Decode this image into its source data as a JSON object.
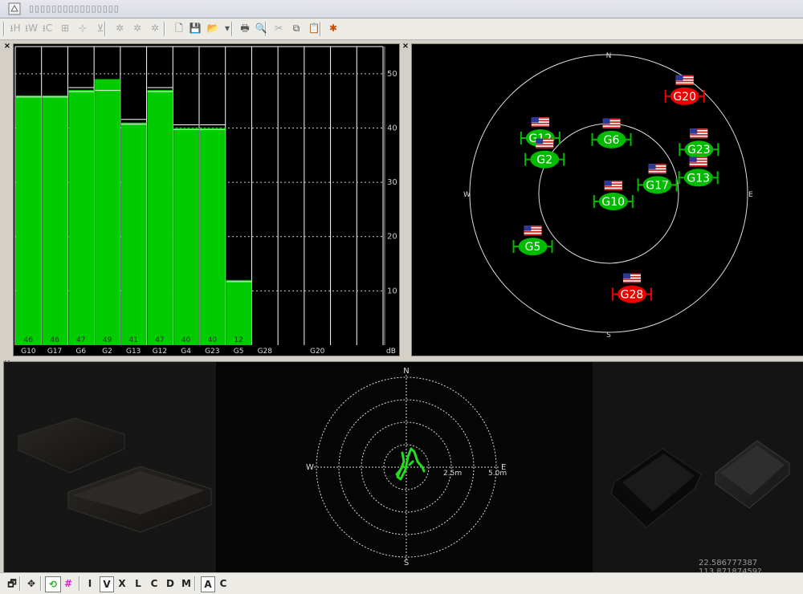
{
  "window": {
    "title": "▯▯▯▯▯▯▯▯▯▯▯▯▯▯▯▯"
  },
  "toolbar": {
    "items": [
      {
        "icon": "hold-h-icon",
        "glyph": "⭳H"
      },
      {
        "icon": "hold-w-icon",
        "glyph": "⭳W"
      },
      {
        "icon": "hold-c-icon",
        "glyph": "⭳C"
      },
      {
        "icon": "grid-add-icon",
        "glyph": "⊞"
      },
      {
        "icon": "grid-move-icon",
        "glyph": "⊹"
      },
      {
        "icon": "grid-split-icon",
        "glyph": "⊻"
      },
      {
        "icon": "settings-gear-1-icon",
        "glyph": "✲"
      },
      {
        "icon": "settings-gear-2-icon",
        "glyph": "✲"
      },
      {
        "icon": "settings-gear-3-icon",
        "glyph": "✲"
      },
      {
        "icon": "new-file-icon",
        "glyph": "🗋"
      },
      {
        "icon": "save-icon",
        "glyph": "💾"
      },
      {
        "icon": "open-folder-icon",
        "glyph": "📂"
      },
      {
        "icon": "dropdown-arrow-icon",
        "glyph": "▾"
      },
      {
        "icon": "print-icon",
        "glyph": "🖶"
      },
      {
        "icon": "print-preview-icon",
        "glyph": "🔍"
      },
      {
        "icon": "cut-icon",
        "glyph": "✂"
      },
      {
        "icon": "copy-icon",
        "glyph": "⧉"
      },
      {
        "icon": "paste-icon",
        "glyph": "📋"
      },
      {
        "icon": "about-icon",
        "glyph": "✱"
      }
    ]
  },
  "snr_chart": {
    "ylabel": "dB",
    "yticks": [
      "10",
      "20",
      "30",
      "40",
      "50"
    ],
    "satellites": [
      {
        "name": "G10",
        "snr": 46,
        "label": "46"
      },
      {
        "name": "G17",
        "snr": 46,
        "label": "46"
      },
      {
        "name": "G6",
        "snr": 47,
        "label": "47"
      },
      {
        "name": "G2",
        "snr": 49,
        "label": "49"
      },
      {
        "name": "G13",
        "snr": 41,
        "label": "41"
      },
      {
        "name": "G12",
        "snr": 47,
        "label": "47"
      },
      {
        "name": "G4",
        "snr": 40,
        "label": "40"
      },
      {
        "name": "G23",
        "snr": 40,
        "label": "40"
      },
      {
        "name": "G5",
        "snr": 12,
        "label": "12"
      },
      {
        "name": "G28",
        "snr": 0,
        "label": ""
      },
      {
        "name": "",
        "snr": 0,
        "label": ""
      },
      {
        "name": "G20",
        "snr": 0,
        "label": ""
      },
      {
        "name": "",
        "snr": 0,
        "label": ""
      },
      {
        "name": "",
        "snr": 0,
        "label": ""
      }
    ],
    "colors": {
      "bar": "#00cc00",
      "grid": "#ffffff",
      "bg": "#000000"
    }
  },
  "skyplot": {
    "compass": {
      "n": "N",
      "s": "S",
      "e": "E",
      "w": "W"
    },
    "satellites": [
      {
        "name": "G20",
        "az": 38,
        "el": 10,
        "used": false
      },
      {
        "name": "G12",
        "az": 309,
        "el": 33,
        "used": true
      },
      {
        "name": "G6",
        "az": 3,
        "el": 55,
        "used": true
      },
      {
        "name": "G23",
        "az": 64,
        "el": 25,
        "used": true
      },
      {
        "name": "G2",
        "az": 298,
        "el": 43,
        "used": true
      },
      {
        "name": "G17",
        "az": 80,
        "el": 58,
        "used": true
      },
      {
        "name": "G13",
        "az": 80,
        "el": 31,
        "used": true
      },
      {
        "name": "G10",
        "az": 150,
        "el": 84,
        "used": true
      },
      {
        "name": "G5",
        "az": 235,
        "el": 30,
        "used": true
      },
      {
        "name": "G28",
        "az": 167,
        "el": 23,
        "used": false
      }
    ],
    "colors": {
      "used": "#00bb00",
      "unused": "#ee0000"
    }
  },
  "scatter": {
    "compass": {
      "n": "N",
      "s": "S",
      "e": "E",
      "w": "W"
    },
    "rings": [
      "2.5m",
      "5.0m"
    ]
  },
  "status": {
    "coords": "22.586777387 113.87187459?"
  },
  "bottombar": {
    "icons": [
      {
        "icon": "properties-icon",
        "glyph": "🗗"
      },
      {
        "icon": "pan-icon",
        "glyph": "✥"
      },
      {
        "icon": "trail-icon",
        "glyph": "⟲"
      },
      {
        "icon": "grid-toggle-icon",
        "glyph": "#"
      }
    ],
    "letters": [
      "I",
      "V",
      "X",
      "L",
      "C",
      "D",
      "M",
      "A",
      "C"
    ]
  }
}
